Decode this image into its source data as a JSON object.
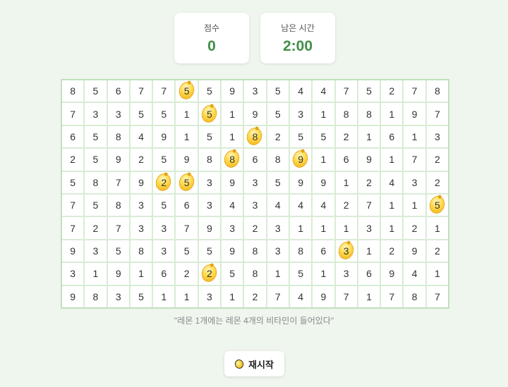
{
  "score": {
    "label": "점수",
    "value": "0"
  },
  "timer": {
    "label": "남은 시간",
    "value": "2:00"
  },
  "board": {
    "rows": [
      [
        8,
        5,
        6,
        7,
        7,
        5,
        5,
        9,
        3,
        5,
        4,
        4,
        7,
        5,
        2,
        7,
        8
      ],
      [
        7,
        3,
        3,
        5,
        5,
        1,
        5,
        1,
        9,
        5,
        3,
        1,
        8,
        8,
        1,
        9,
        7
      ],
      [
        6,
        5,
        8,
        4,
        9,
        1,
        5,
        1,
        8,
        2,
        5,
        5,
        2,
        1,
        6,
        1,
        3
      ],
      [
        2,
        5,
        9,
        2,
        5,
        9,
        8,
        8,
        6,
        8,
        9,
        1,
        6,
        9,
        1,
        7,
        2
      ],
      [
        5,
        8,
        7,
        9,
        2,
        5,
        3,
        9,
        3,
        5,
        9,
        9,
        1,
        2,
        4,
        3,
        2
      ],
      [
        7,
        5,
        8,
        3,
        5,
        6,
        3,
        4,
        3,
        4,
        4,
        4,
        2,
        7,
        1,
        1,
        5
      ],
      [
        7,
        2,
        7,
        3,
        3,
        7,
        9,
        3,
        2,
        3,
        1,
        1,
        1,
        3,
        1,
        2,
        1
      ],
      [
        9,
        3,
        5,
        8,
        3,
        5,
        5,
        9,
        8,
        3,
        8,
        6,
        3,
        1,
        2,
        9,
        2
      ],
      [
        3,
        1,
        9,
        1,
        6,
        2,
        2,
        5,
        8,
        1,
        5,
        1,
        3,
        6,
        9,
        4,
        1
      ],
      [
        9,
        8,
        3,
        5,
        1,
        1,
        3,
        1,
        2,
        7,
        4,
        9,
        7,
        1,
        7,
        8,
        7
      ]
    ],
    "lemons": [
      [
        0,
        5
      ],
      [
        1,
        6
      ],
      [
        2,
        8
      ],
      [
        3,
        7
      ],
      [
        3,
        10
      ],
      [
        4,
        4
      ],
      [
        4,
        5
      ],
      [
        5,
        16
      ],
      [
        7,
        12
      ],
      [
        8,
        6
      ]
    ]
  },
  "quote": "\"레몬 1개에는 레몬 4개의 비타민이 들어있다\"",
  "restart": {
    "label": "재시작",
    "icon": "lemon-icon"
  }
}
